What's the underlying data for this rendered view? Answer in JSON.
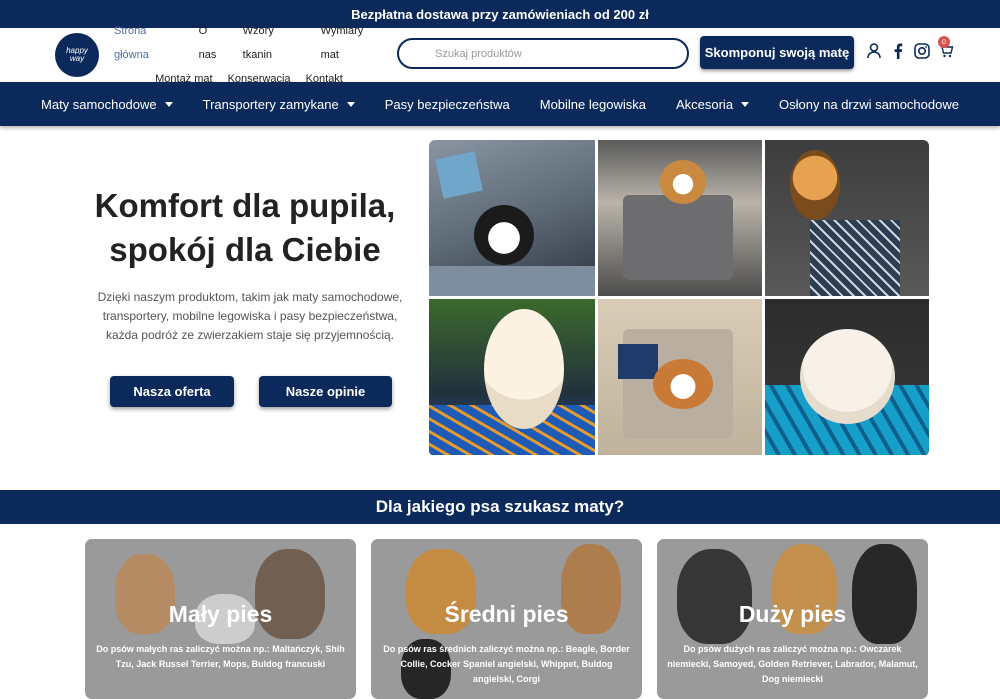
{
  "topbar": {
    "text": "Bezpłatna dostawa przy zamówieniach od 200 zł"
  },
  "logo": {
    "line1": "happy",
    "line2": "way"
  },
  "toplinks": {
    "row1": [
      "Strona główna",
      "O nas",
      "Wzory tkanin",
      "Wymiary mat"
    ],
    "row2": [
      "Montaż mat",
      "Konserwacja",
      "Kontakt"
    ]
  },
  "search": {
    "placeholder": "Szukaj produktów"
  },
  "compose_button": "Skomponuj swoją matę",
  "cart": {
    "count": "0"
  },
  "nav": [
    {
      "label": "Maty samochodowe",
      "dropdown": true
    },
    {
      "label": "Transportery zamykane",
      "dropdown": true
    },
    {
      "label": "Pasy bezpieczeństwa",
      "dropdown": false
    },
    {
      "label": "Mobilne legowiska",
      "dropdown": false
    },
    {
      "label": "Akcesoria",
      "dropdown": true
    },
    {
      "label": "Osłony na drzwi samochodowe",
      "dropdown": false
    }
  ],
  "hero": {
    "title_line1": "Komfort dla pupila,",
    "title_line2": "spokój dla Ciebie",
    "text": "Dzięki naszym produktom, takim jak maty samochodowe, transportery, mobilne legowiska i pasy bezpieczeństwa, każda podróż ze zwierzakiem staje się przyjemnością.",
    "btn_offer": "Nasza oferta",
    "btn_reviews": "Nasze opinie"
  },
  "section": {
    "title": "Dla jakiego psa szukasz maty?"
  },
  "cards": [
    {
      "title": "Mały pies",
      "desc": "Do psów małych ras zaliczyć można np.: Maltańczyk, Shih Tzu, Jack Russel Terrier, Mops, Buldog francuski"
    },
    {
      "title": "Średni pies",
      "desc": "Do psów ras średnich zaliczyć można np.: Beagle, Border Collie, Cocker Spaniel angielski, Whippet, Buldog angielski, Corgi"
    },
    {
      "title": "Duży pies",
      "desc": "Do psów dużych ras zaliczyć można np.: Owczarek niemiecki, Samoyed, Golden Retriever, Labrador, Malamut, Dog niemiecki"
    }
  ],
  "colors": {
    "brand": "#0b2a5b",
    "card_bg": "#9a9a9a",
    "badge": "#d9534f"
  }
}
